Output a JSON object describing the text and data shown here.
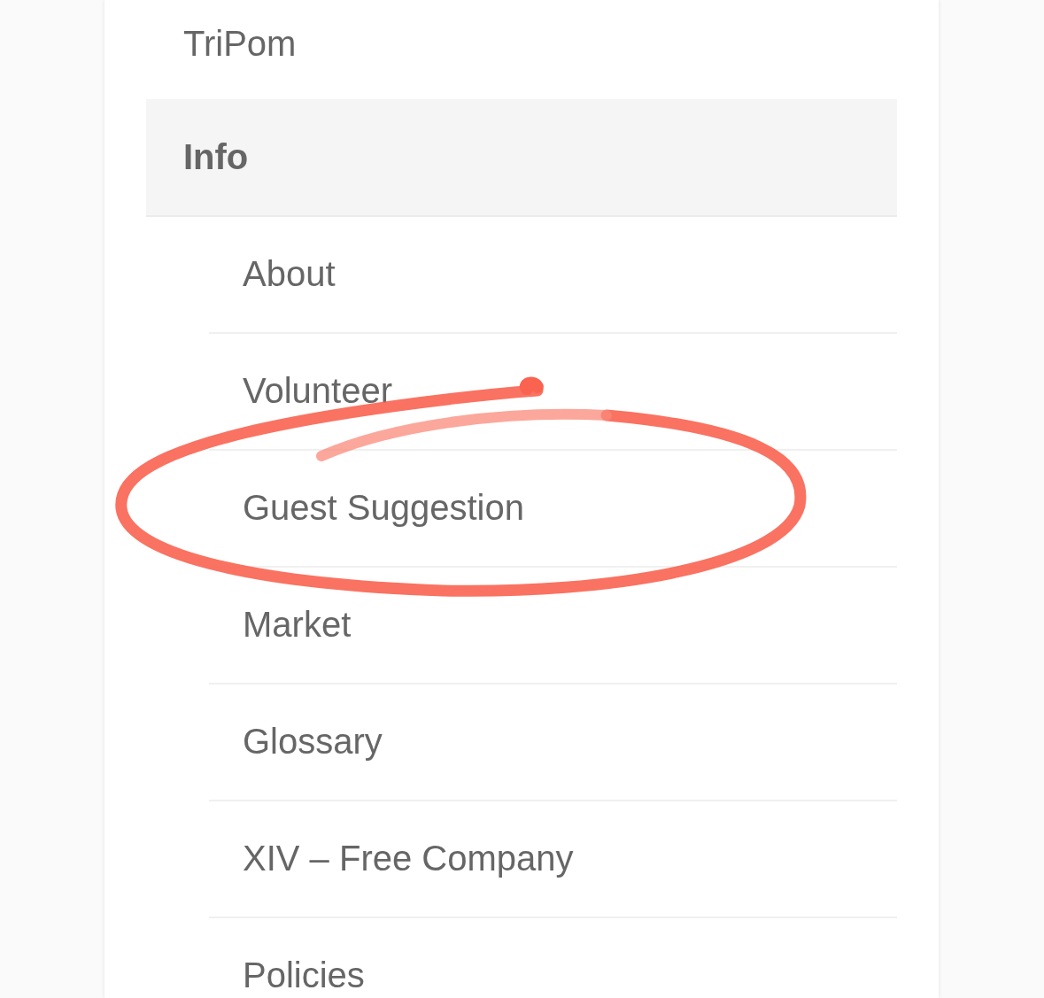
{
  "menu": [
    {
      "label": "TriPom",
      "selected": false
    },
    {
      "label": "Info",
      "selected": true,
      "children": [
        {
          "label": "About",
          "selected": false,
          "circled": false
        },
        {
          "label": "Volunteer",
          "selected": false,
          "circled": false
        },
        {
          "label": "Guest Suggestion",
          "selected": false,
          "circled": true
        },
        {
          "label": "Market",
          "selected": false,
          "circled": false
        },
        {
          "label": "Glossary",
          "selected": false,
          "circled": false
        },
        {
          "label": "XIV – Free Company",
          "selected": false,
          "circled": false
        },
        {
          "label": "Policies",
          "selected": false,
          "circled": false
        }
      ]
    }
  ]
}
